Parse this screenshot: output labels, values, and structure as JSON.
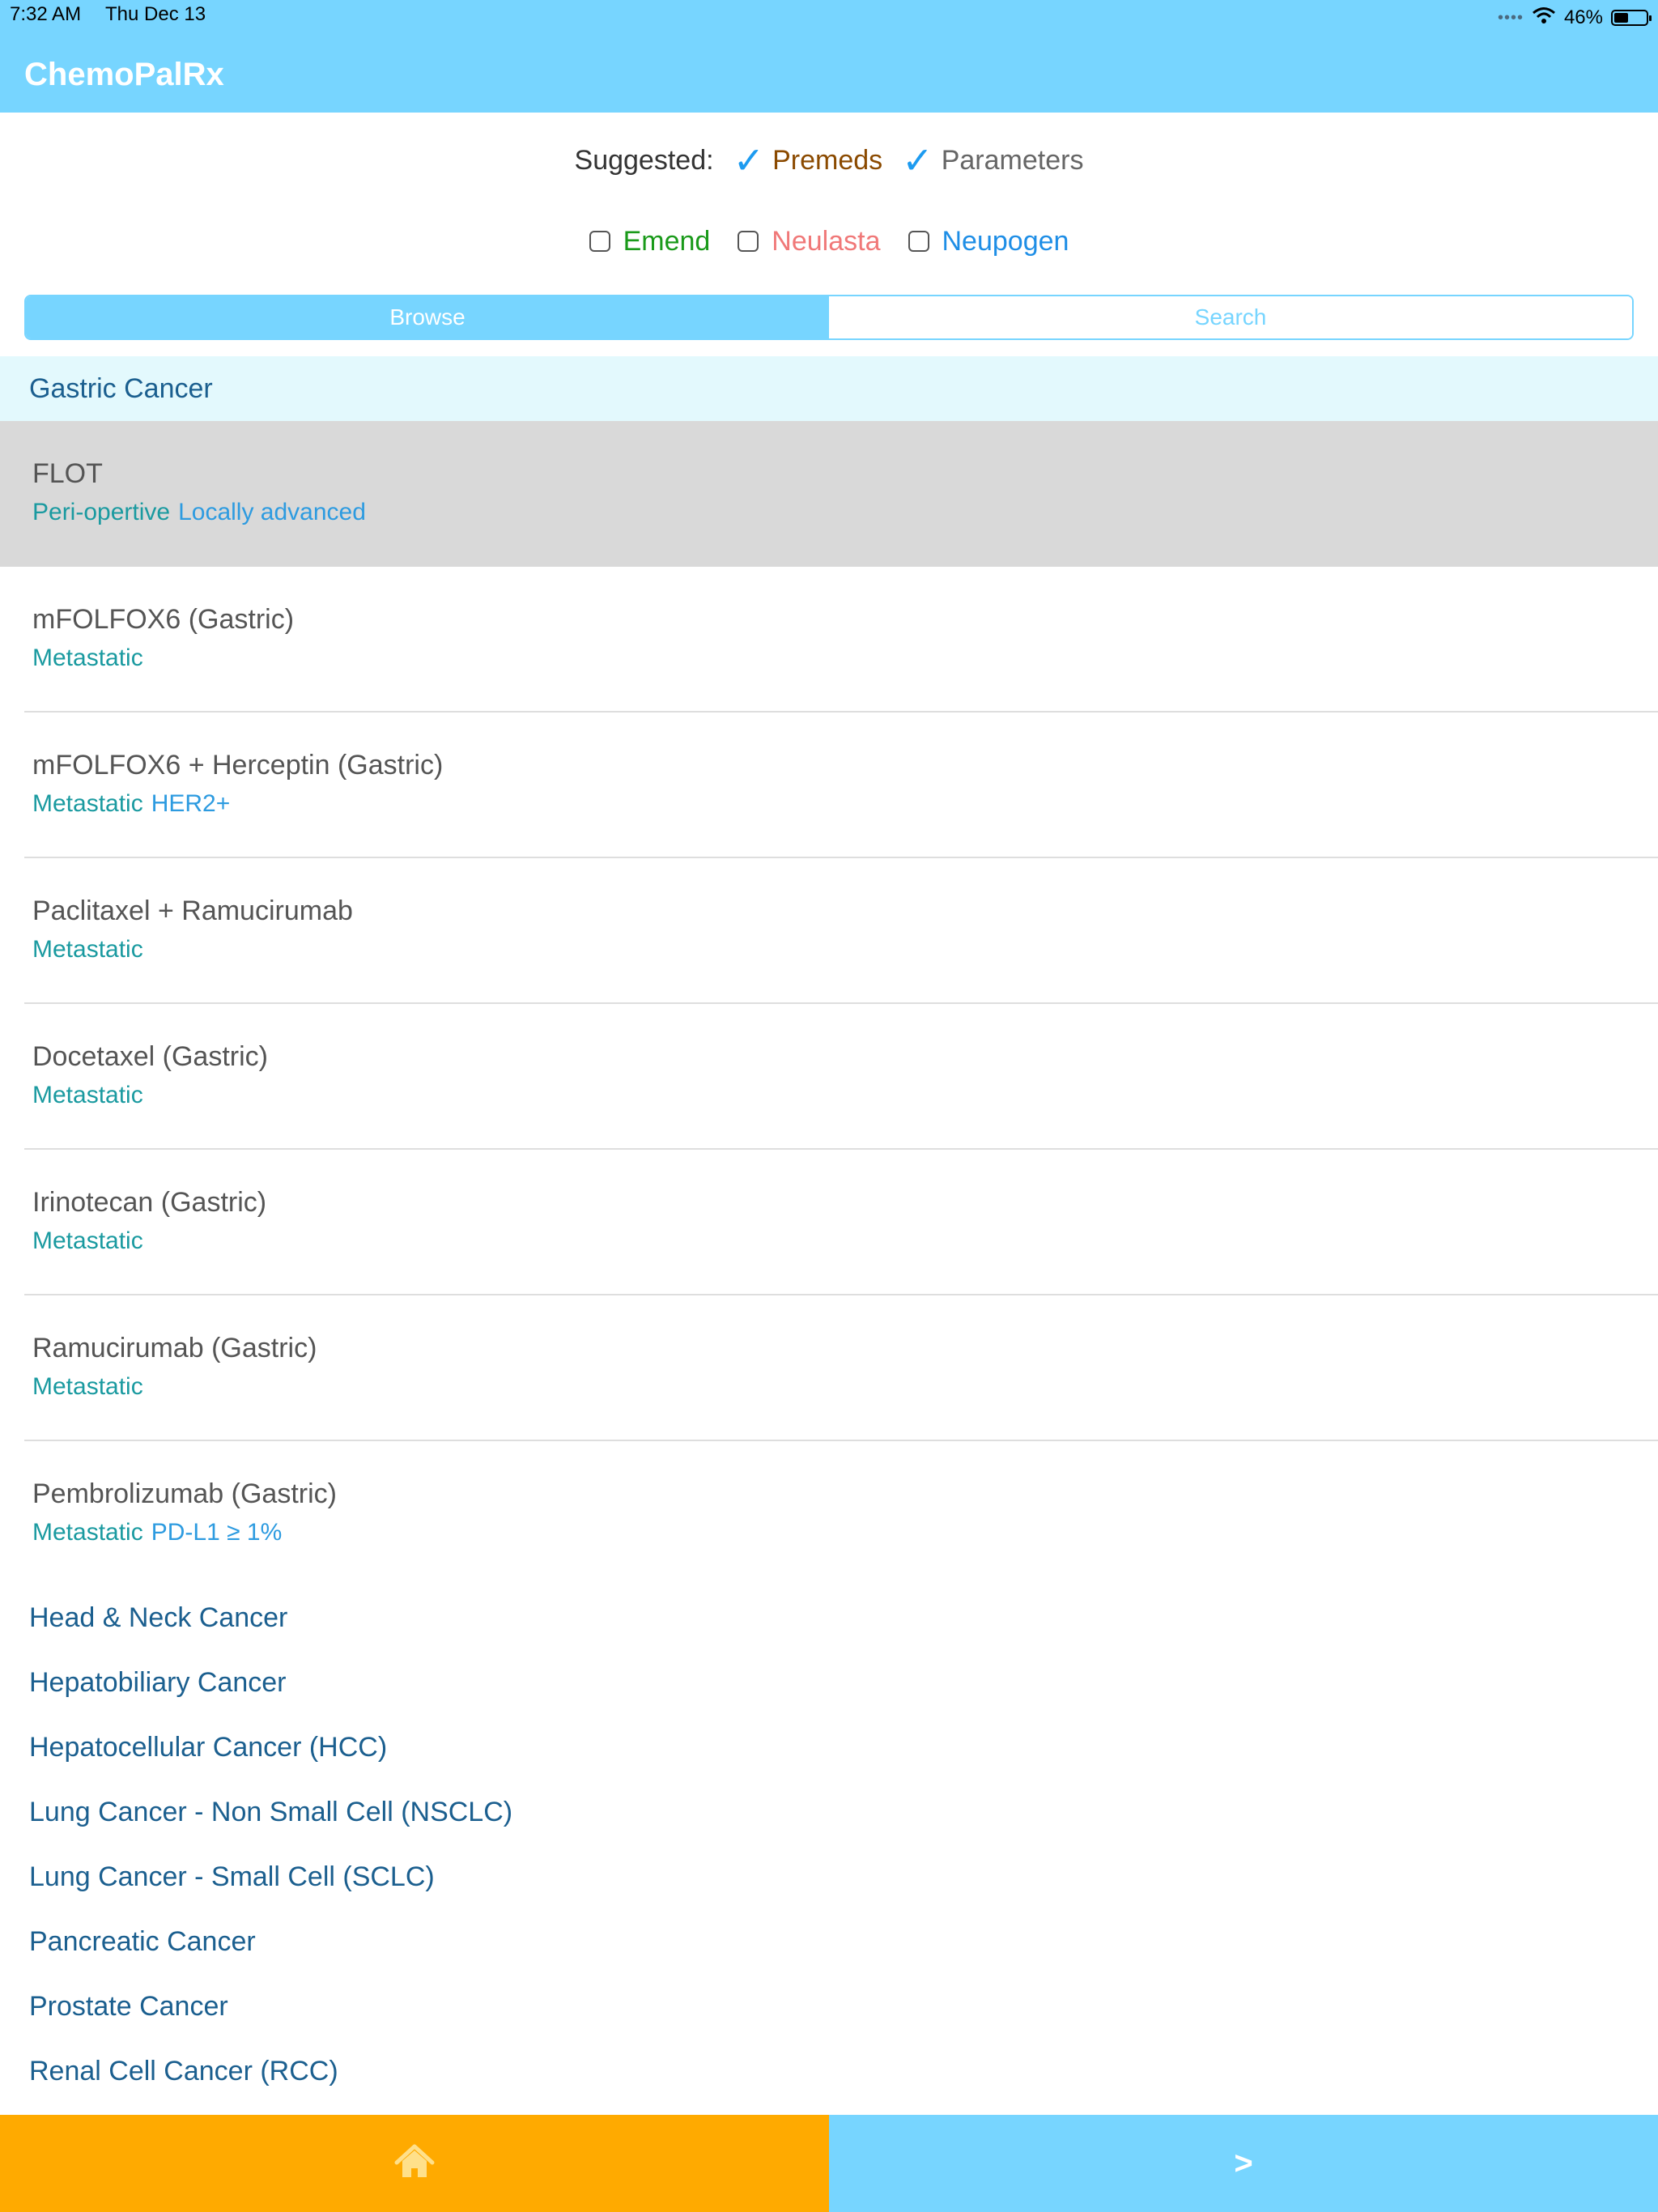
{
  "status_bar": {
    "time": "7:32 AM",
    "date": "Thu Dec 13",
    "battery": "46%",
    "battery_level": 0.46
  },
  "app": {
    "title": "ChemoPalRx"
  },
  "suggested": {
    "label": "Suggested:",
    "items": [
      {
        "label": "Premeds",
        "checked": true,
        "color": "#8b4a00"
      },
      {
        "label": "Parameters",
        "checked": true,
        "color": "#666666"
      }
    ]
  },
  "drug_options": [
    {
      "label": "Emend",
      "checked": false,
      "color": "#1a9a1a"
    },
    {
      "label": "Neulasta",
      "checked": false,
      "color": "#f07878"
    },
    {
      "label": "Neupogen",
      "checked": false,
      "color": "#1e8ee6"
    }
  ],
  "segment": {
    "browse": "Browse",
    "search": "Search",
    "selected": "Browse"
  },
  "section": {
    "title": "Gastric Cancer"
  },
  "regimens": [
    {
      "title": "FLOT",
      "tags": [
        "Peri-opertive",
        "Locally advanced"
      ],
      "selected": true
    },
    {
      "title": "mFOLFOX6 (Gastric)",
      "tags": [
        "Metastatic"
      ]
    },
    {
      "title": "mFOLFOX6 + Herceptin (Gastric)",
      "tags": [
        "Metastatic",
        "HER2+"
      ]
    },
    {
      "title": "Paclitaxel + Ramucirumab",
      "tags": [
        "Metastatic"
      ]
    },
    {
      "title": "Docetaxel (Gastric)",
      "tags": [
        "Metastatic"
      ]
    },
    {
      "title": "Irinotecan (Gastric)",
      "tags": [
        "Metastatic"
      ]
    },
    {
      "title": "Ramucirumab (Gastric)",
      "tags": [
        "Metastatic"
      ]
    },
    {
      "title": "Pembrolizumab (Gastric)",
      "tags": [
        "Metastatic",
        "PD-L1 ≥ 1%"
      ]
    }
  ],
  "categories": [
    "Head & Neck Cancer",
    "Hepatobiliary Cancer",
    "Hepatocellular Cancer (HCC)",
    "Lung Cancer - Non Small Cell (NSCLC)",
    "Lung Cancer - Small Cell (SCLC)",
    "Pancreatic Cancer",
    "Prostate Cancer",
    "Renal Cell Cancer (RCC)"
  ],
  "bottom_bar": {
    "home_icon": "home-icon",
    "next_label": ">",
    "home_color": "#ffaa00",
    "next_color": "#77d5ff"
  }
}
